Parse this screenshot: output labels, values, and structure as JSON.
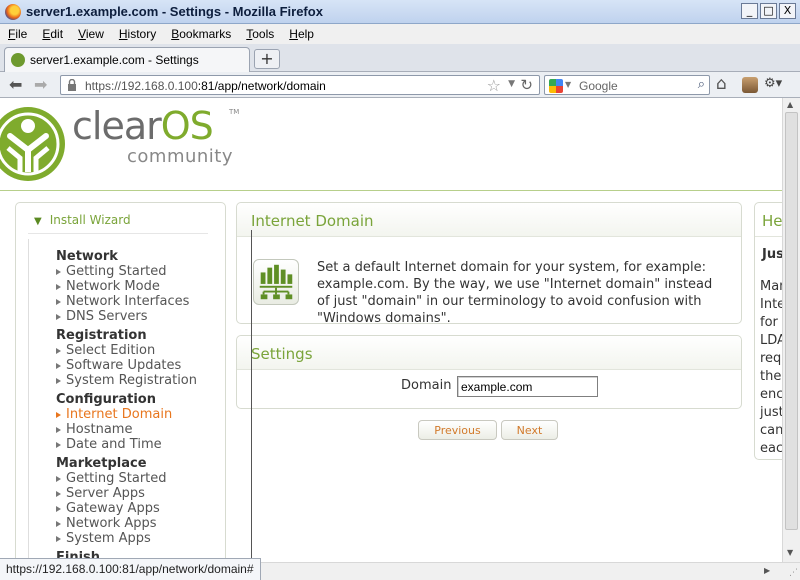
{
  "window": {
    "title": "server1.example.com - Settings - Mozilla Firefox",
    "minimize": "_",
    "maximize": "□",
    "close": "X"
  },
  "menu": [
    "File",
    "Edit",
    "View",
    "History",
    "Bookmarks",
    "Tools",
    "Help"
  ],
  "menu_underline": [
    "F",
    "E",
    "V",
    "H",
    "B",
    "T",
    "H"
  ],
  "tab": {
    "title": "server1.example.com - Settings",
    "new_tab": "+"
  },
  "nav": {
    "url_host": "https://192.168.0.100",
    "url_rest": ":81/app/network/domain",
    "search_placeholder": "Google"
  },
  "logo": {
    "text_main": "clear",
    "text_accent": "OS",
    "tm": "TM",
    "subtitle": "community"
  },
  "sidebar": {
    "heading": "Install Wizard",
    "groups": [
      {
        "name": "Network",
        "items": [
          {
            "label": "Getting Started",
            "active": false
          },
          {
            "label": "Network Mode",
            "active": false
          },
          {
            "label": "Network Interfaces",
            "active": false
          },
          {
            "label": "DNS Servers",
            "active": false
          }
        ]
      },
      {
        "name": "Registration",
        "items": [
          {
            "label": "Select Edition",
            "active": false
          },
          {
            "label": "Software Updates",
            "active": false
          },
          {
            "label": "System Registration",
            "active": false
          }
        ]
      },
      {
        "name": "Configuration",
        "items": [
          {
            "label": "Internet Domain",
            "active": true
          },
          {
            "label": "Hostname",
            "active": false
          },
          {
            "label": "Date and Time",
            "active": false
          }
        ]
      },
      {
        "name": "Marketplace",
        "items": [
          {
            "label": "Getting Started",
            "active": false
          },
          {
            "label": "Server Apps",
            "active": false
          },
          {
            "label": "Gateway Apps",
            "active": false
          },
          {
            "label": "Network Apps",
            "active": false
          },
          {
            "label": "System Apps",
            "active": false
          }
        ]
      },
      {
        "name": "Finish",
        "items": []
      }
    ]
  },
  "info_panel": {
    "title": "Internet Domain",
    "text": "Set a default Internet domain for your system, for example: example.com. By the way, we use \"Internet domain\" instead of just \"domain\" in our terminology to avoid confusion with \"Windows domains\"."
  },
  "settings_panel": {
    "title": "Settings",
    "domain_label": "Domain",
    "domain_value": "example.com"
  },
  "buttons": {
    "previous": "Previous",
    "next": "Next"
  },
  "help_panel": {
    "title": "Help",
    "subtitle": "Just",
    "lines": [
      "Man",
      "Inte",
      "for",
      "LDA",
      "requ",
      "the",
      "enc",
      "just",
      "can",
      "each"
    ]
  },
  "status": {
    "text": "https://192.168.0.100:81/app/network/domain#"
  },
  "colors": {
    "accent_green": "#7aa43a",
    "active_orange": "#e8761e",
    "button_text": "#d27a2b"
  }
}
